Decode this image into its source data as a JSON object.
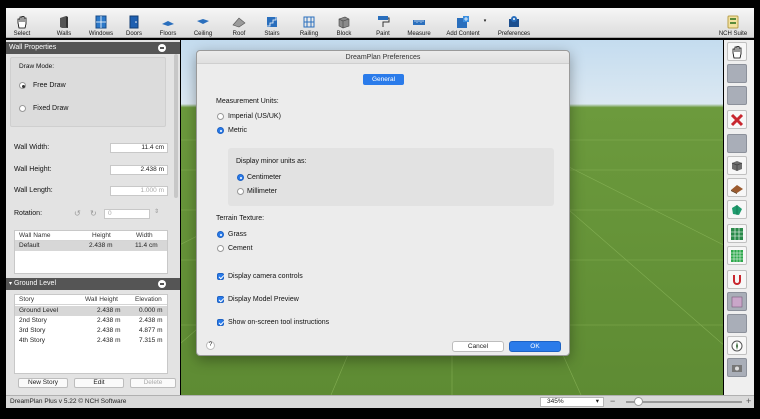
{
  "toolbar": {
    "select": "Select",
    "walls": "Walls",
    "windows": "Windows",
    "doors": "Doors",
    "floors": "Floors",
    "ceiling": "Ceiling",
    "roof": "Roof",
    "stairs": "Stairs",
    "railing": "Railing",
    "block": "Block",
    "paint": "Paint",
    "measure": "Measure",
    "add_content": "Add Content",
    "preferences": "Preferences",
    "nch_suite": "NCH Suite"
  },
  "wall_properties": {
    "title": "Wall Properties",
    "draw_mode_label": "Draw Mode:",
    "free_draw": "Free Draw",
    "fixed_draw": "Fixed Draw",
    "wall_width_label": "Wall Width:",
    "wall_width_value": "11.4 cm",
    "wall_height_label": "Wall Height:",
    "wall_height_value": "2.438 m",
    "wall_length_label": "Wall Length:",
    "wall_length_value": "1.000 m",
    "rotation_label": "Rotation:",
    "rotation_value": "0",
    "table_headers": [
      "Wall Name",
      "Height",
      "Width"
    ],
    "rows": [
      {
        "name": "Default",
        "height": "2.438 m",
        "width": "11.4 cm"
      }
    ]
  },
  "ground_level": {
    "title": "Ground Level",
    "headers": [
      "Story",
      "Wall Height",
      "Elevation"
    ],
    "rows": [
      {
        "story": "Ground Level",
        "wall_height": "2.438 m",
        "elevation": "0.000 m"
      },
      {
        "story": "2nd Story",
        "wall_height": "2.438 m",
        "elevation": "2.438 m"
      },
      {
        "story": "3rd Story",
        "wall_height": "2.438 m",
        "elevation": "4.877 m"
      },
      {
        "story": "4th Story",
        "wall_height": "2.438 m",
        "elevation": "7.315 m"
      }
    ],
    "new_story": "New Story",
    "edit": "Edit",
    "delete": "Delete"
  },
  "status": {
    "app_version": "DreamPlan Plus v 5.22 © NCH Software",
    "zoom": "345%"
  },
  "dialog": {
    "title": "DreamPlan Preferences",
    "tab": "General",
    "measurement_units_label": "Measurement Units:",
    "imperial": "Imperial (US/UK)",
    "metric": "Metric",
    "minor_units_label": "Display minor units as:",
    "centimeter": "Centimeter",
    "millimeter": "Millimeter",
    "terrain_label": "Terrain Texture:",
    "grass": "Grass",
    "cement": "Cement",
    "camera_controls": "Display camera controls",
    "model_preview": "Display Model Preview",
    "onscreen_instructions": "Show on-screen tool instructions",
    "help": "?",
    "cancel": "Cancel",
    "ok": "OK"
  },
  "colors": {
    "accent": "#2a7bea",
    "panel_header": "#555555",
    "grass": "#5e8b33"
  }
}
